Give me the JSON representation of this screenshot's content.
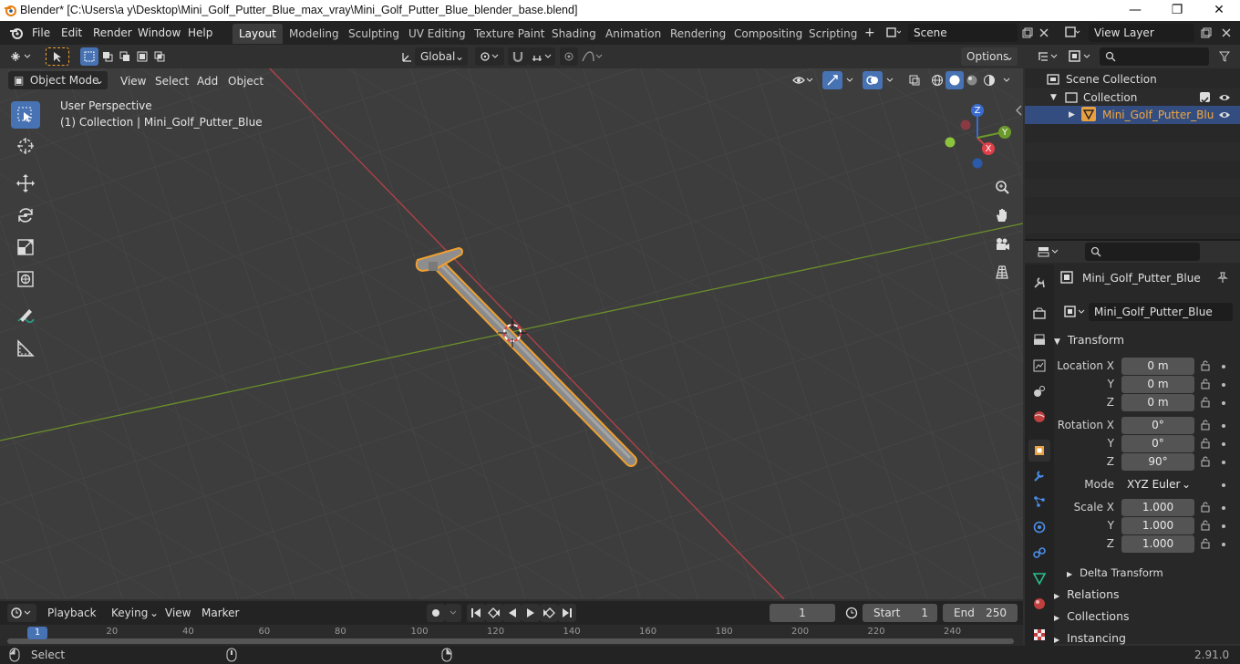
{
  "window": {
    "title": "Blender* [C:\\Users\\a y\\Desktop\\Mini_Golf_Putter_Blue_max_vray\\Mini_Golf_Putter_Blue_blender_base.blend]",
    "minimize": "—",
    "maximize": "❐",
    "close": "✕"
  },
  "menubar": {
    "items": [
      "File",
      "Edit",
      "Render",
      "Window",
      "Help"
    ],
    "workspaces": [
      "Layout",
      "Modeling",
      "Sculpting",
      "UV Editing",
      "Texture Paint",
      "Shading",
      "Animation",
      "Rendering",
      "Compositing",
      "Scripting"
    ],
    "active_workspace": "Layout",
    "add_tab": "+",
    "scene_label": "Scene",
    "view_layer_label": "View Layer"
  },
  "viewport_header": {
    "mode": "Object Mode",
    "menus": [
      "View",
      "Select",
      "Add",
      "Object"
    ],
    "transform_orientation": "Global",
    "options": "Options"
  },
  "viewport": {
    "perspective_label": "User Perspective",
    "collection_label": "(1) Collection | Mini_Golf_Putter_Blue",
    "gizmo_axes": {
      "x": "X",
      "y": "Y",
      "z": "Z"
    },
    "colors": {
      "x_axis": "#b8404a",
      "y_axis": "#6b8f2a",
      "selection": "#f0a030",
      "grid_bg": "#3d3d3d"
    }
  },
  "outliner": {
    "scene_collection": "Scene Collection",
    "collection": "Collection",
    "object": "Mini_Golf_Putter_Blu"
  },
  "properties": {
    "object_name": "Mini_Golf_Putter_Blue",
    "object_field": "Mini_Golf_Putter_Blue",
    "transform_title": "Transform",
    "location_label": "Location X",
    "rotation_label": "Rotation X",
    "scale_label": "Scale X",
    "y_label": "Y",
    "z_label": "Z",
    "location": [
      "0 m",
      "0 m",
      "0 m"
    ],
    "rotation": [
      "0°",
      "0°",
      "90°"
    ],
    "mode_label": "Mode",
    "mode_value": "XYZ Euler",
    "scale": [
      "1.000",
      "1.000",
      "1.000"
    ],
    "sections": [
      "Delta Transform",
      "Relations",
      "Collections",
      "Instancing"
    ]
  },
  "timeline": {
    "menus": [
      "Playback",
      "Keying",
      "View",
      "Marker"
    ],
    "current_frame": "1",
    "start_label": "Start",
    "start_value": "1",
    "end_label": "End",
    "end_value": "250",
    "ruler": [
      "1",
      "20",
      "40",
      "60",
      "80",
      "100",
      "120",
      "140",
      "160",
      "180",
      "200",
      "220",
      "240"
    ]
  },
  "statusbar": {
    "left": "Select",
    "version": "2.91.0"
  }
}
